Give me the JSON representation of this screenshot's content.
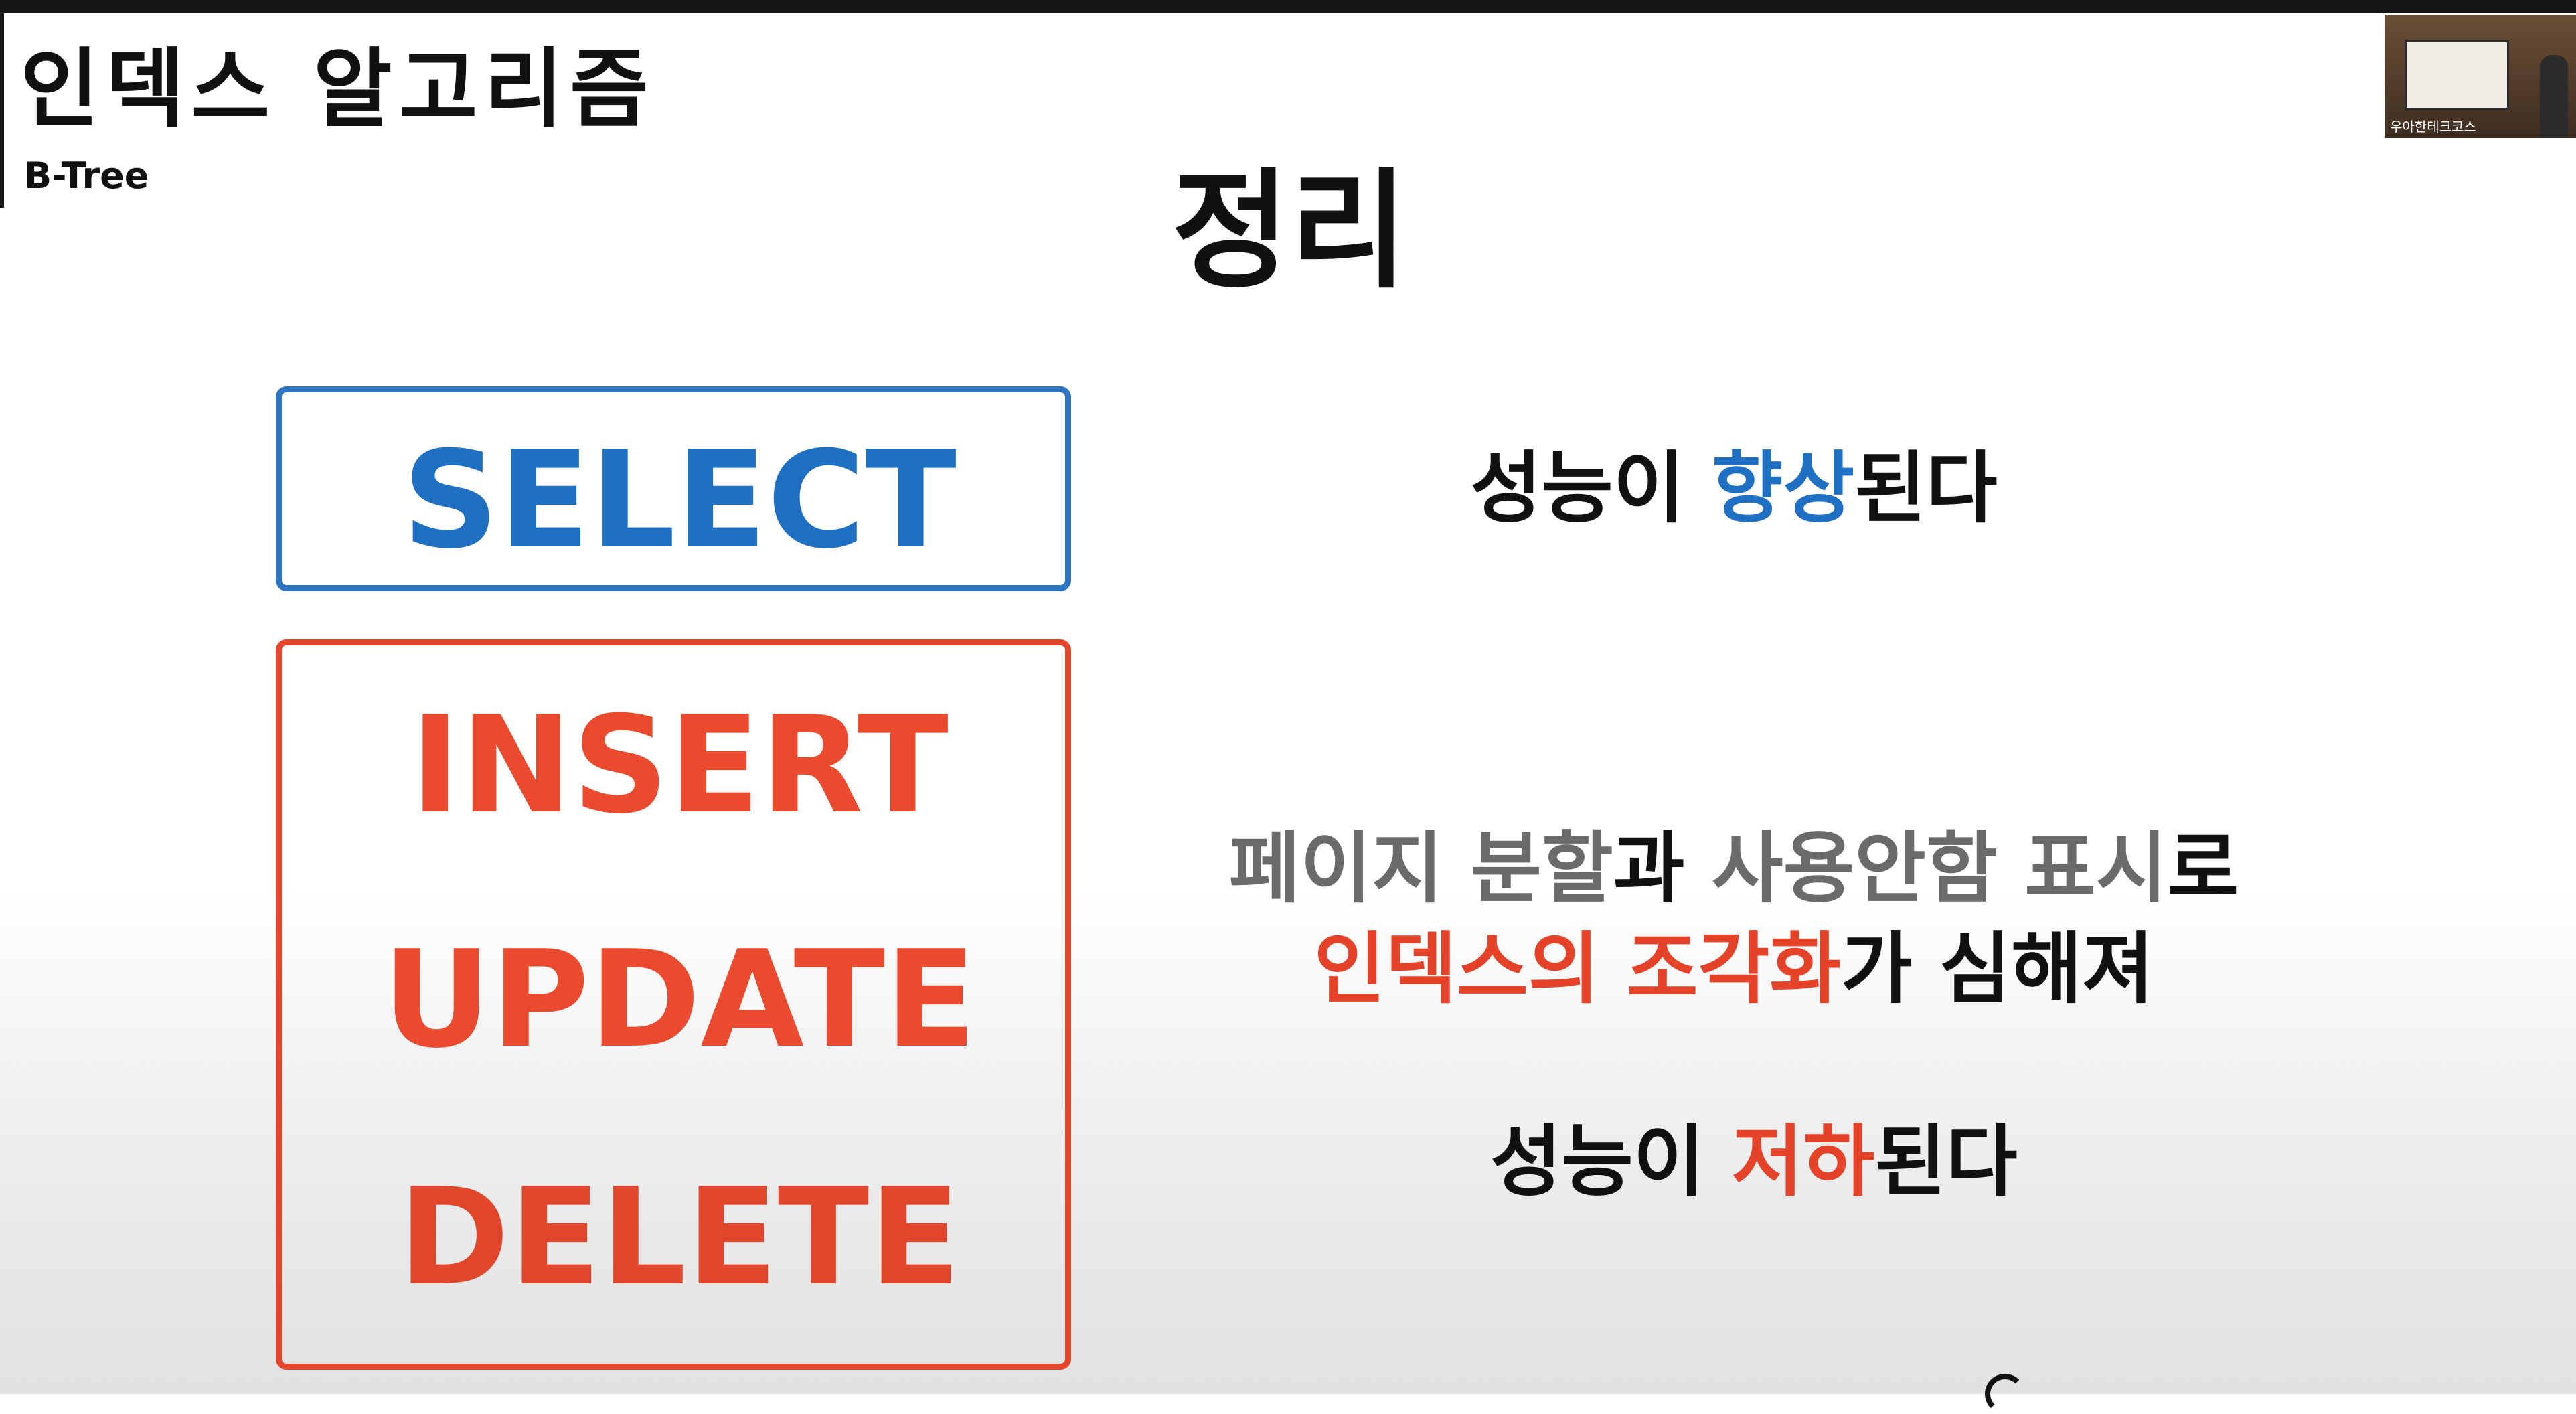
{
  "header": {
    "deck_title": "인덱스 알고리즘",
    "deck_subtitle": "B-Tree",
    "slide_title": "정리"
  },
  "thumbnail": {
    "caption": "우아한테크코스"
  },
  "keywords": {
    "select": "SELECT",
    "insert": "INSERT",
    "update": "UPDATE",
    "delete": "DELETE"
  },
  "statements": {
    "select_result": {
      "prefix": "성능이 ",
      "highlight": "향상",
      "suffix": "된다"
    },
    "modify_reason_line1": {
      "part1": "페이지 분할",
      "part2": "과 ",
      "part3": "사용안함 표시",
      "part4": "로"
    },
    "modify_reason_line2": {
      "part1": "인덱스의 조각화",
      "part2": "가 심해져"
    },
    "modify_result": {
      "prefix": "성능이 ",
      "highlight": "저하",
      "suffix": "된다"
    }
  },
  "colors": {
    "select_accent": "#1f6fc2",
    "modify_accent": "#e4432a",
    "muted_text": "#6a6a6a",
    "primary_text": "#111111"
  }
}
